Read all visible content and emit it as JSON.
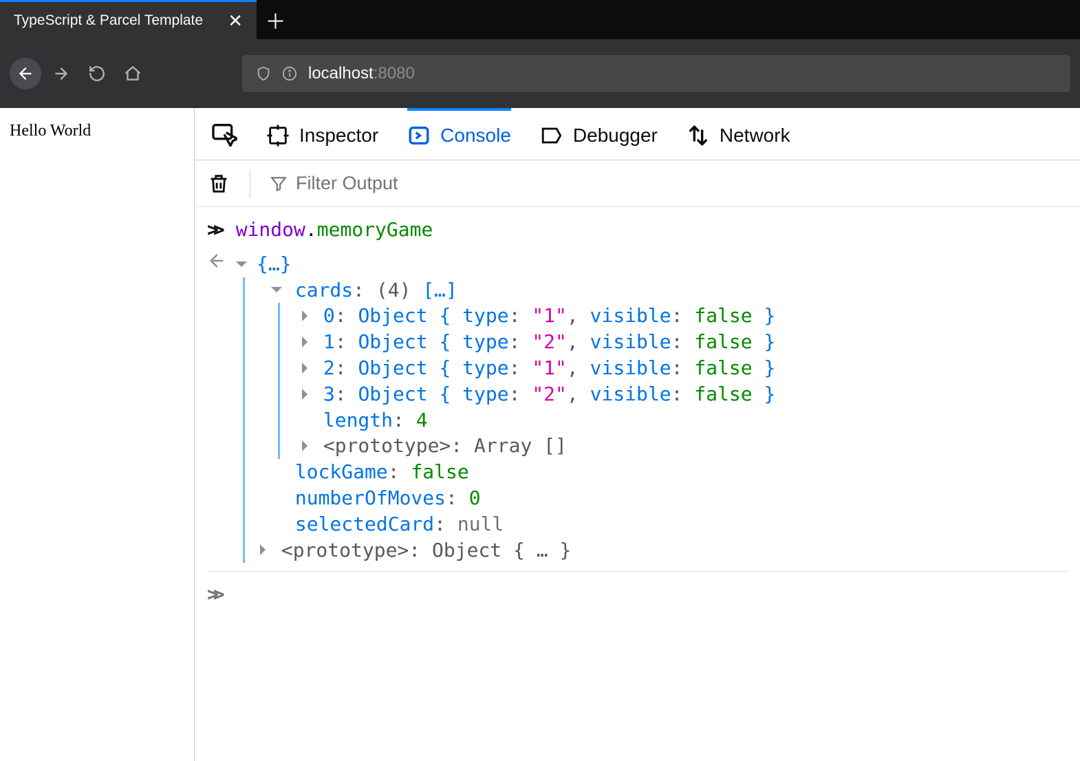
{
  "browser": {
    "tab_title": "TypeScript & Parcel Template",
    "url_host": "localhost",
    "url_port": ":8080"
  },
  "page": {
    "heading": "Hello World"
  },
  "devtools": {
    "tabs": {
      "inspector": "Inspector",
      "console": "Console",
      "debugger": "Debugger",
      "network": "Network"
    },
    "filter_placeholder": "Filter Output",
    "input_expression": {
      "window": "window",
      "dot": ".",
      "prop": "memoryGame"
    },
    "result": {
      "brace_summary": "{…}",
      "cards_label": "cards",
      "cards_count": "(4)",
      "cards_brackets": "[…]",
      "items": [
        {
          "idx": "0",
          "type": "\"1\"",
          "visible": "false"
        },
        {
          "idx": "1",
          "type": "\"2\"",
          "visible": "false"
        },
        {
          "idx": "2",
          "type": "\"1\"",
          "visible": "false"
        },
        {
          "idx": "3",
          "type": "\"2\"",
          "visible": "false"
        }
      ],
      "length_label": "length",
      "length_value": "4",
      "proto_array_label": "<prototype>",
      "proto_array_value": "Array []",
      "lockGame_label": "lockGame",
      "lockGame_value": "false",
      "numberOfMoves_label": "numberOfMoves",
      "numberOfMoves_value": "0",
      "selectedCard_label": "selectedCard",
      "selectedCard_value": "null",
      "proto_obj_label": "<prototype>",
      "proto_obj_value": "Object { … }",
      "object_word": "Object",
      "type_word": "type",
      "visible_word": "visible"
    }
  }
}
